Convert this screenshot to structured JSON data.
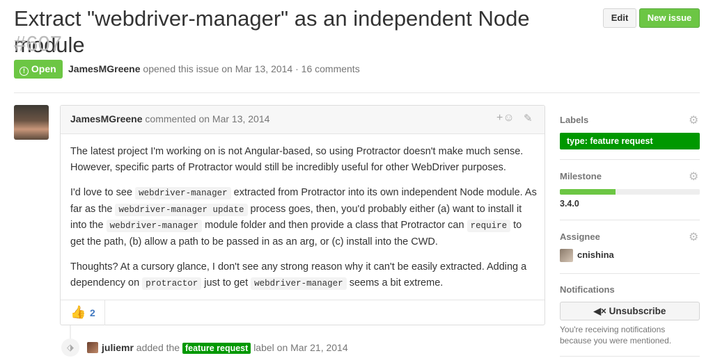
{
  "issue": {
    "title": "Extract \"webdriver-manager\" as an independent Node module",
    "number": "#607",
    "state": "Open",
    "author": "JamesMGreene",
    "opened_text": "opened this issue on Mar 13, 2014 · 16 comments"
  },
  "header_buttons": {
    "edit": "Edit",
    "new_issue": "New issue"
  },
  "comment": {
    "author": "JamesMGreene",
    "meta": "commented on Mar 13, 2014",
    "p1": "The latest project I'm working on is not Angular-based, so using Protractor doesn't make much sense. However, specific parts of Protractor would still be incredibly useful for other WebDriver purposes.",
    "p2": {
      "a": "I'd love to see",
      "code1": "webdriver-manager",
      "b": "extracted from Protractor into its own independent Node module. As far as the",
      "code2": "webdriver-manager update",
      "c": "process goes, then, you'd probably either (a) want to install it into the",
      "code3": "webdriver-manager",
      "d": "module folder and then provide a class that Protractor can",
      "code4": "require",
      "e": "to get the path, (b) allow a path to be passed in as an arg, or (c) install into the CWD."
    },
    "p3": {
      "a": "Thoughts? At a cursory glance, I don't see any strong reason why it can't be easily extracted. Adding a dependency on",
      "code1": "protractor",
      "b": "just to get",
      "code2": "webdriver-manager",
      "c": "seems a bit extreme."
    },
    "reaction_count": "2"
  },
  "event": {
    "user": "juliemr",
    "action": "added the",
    "label": "feature request",
    "suffix": "label on Mar 21, 2014"
  },
  "sidebar": {
    "labels_heading": "Labels",
    "label": "type: feature request",
    "milestone_heading": "Milestone",
    "milestone_progress": 0.4,
    "milestone_name": "3.4.0",
    "assignee_heading": "Assignee",
    "assignee": "cnishina",
    "notifications_heading": "Notifications",
    "unsubscribe": "Unsubscribe",
    "notification_note": "You're receiving notifications because you were mentioned."
  },
  "colors": {
    "green": "#6cc644",
    "label_green": "#009800",
    "link_blue": "#4078c0"
  },
  "icons": [
    "open-issue-icon",
    "emoji-add-icon",
    "pencil-icon",
    "gear-icon",
    "thumbs-up-icon",
    "tag-icon",
    "mute-icon"
  ]
}
